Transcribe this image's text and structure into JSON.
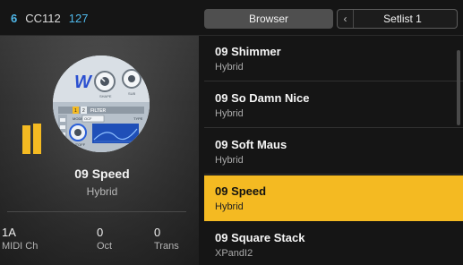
{
  "topbar": {
    "channel": "6",
    "cc_label": "CC112",
    "cc_value": "127",
    "browser_label": "Browser",
    "setlist_label": "Setlist 1"
  },
  "current_patch": {
    "name": "09 Speed",
    "type": "Hybrid",
    "thumbnail_text": {
      "logo": "W",
      "knob1": "SHAPE",
      "knob2": "SUB",
      "section_a": "1",
      "section_b": "2",
      "section_title": "FILTER",
      "mode_label": "MODE",
      "mode_value": "OCF",
      "type_label": "TYPE",
      "cutoff_label": "CUTOFF"
    }
  },
  "stats": [
    {
      "value": "1A",
      "label": "MIDI Ch"
    },
    {
      "value": "0",
      "label": "Oct"
    },
    {
      "value": "0",
      "label": "Trans"
    }
  ],
  "patches": [
    {
      "name": "09 Shimmer",
      "type": "Hybrid",
      "selected": false
    },
    {
      "name": "09 So Damn Nice",
      "type": "Hybrid",
      "selected": false
    },
    {
      "name": "09 Soft Maus",
      "type": "Hybrid",
      "selected": false
    },
    {
      "name": "09 Speed",
      "type": "Hybrid",
      "selected": true
    },
    {
      "name": "09 Square Stack",
      "type": "XPandI2",
      "selected": false
    }
  ],
  "colors": {
    "accent": "#f4ba22",
    "channel_blue": "#4fb8ea",
    "background": "#151515"
  },
  "icons": {
    "setlist_prev": "chevron-left-icon",
    "level_meter": "level-meter-icon"
  }
}
